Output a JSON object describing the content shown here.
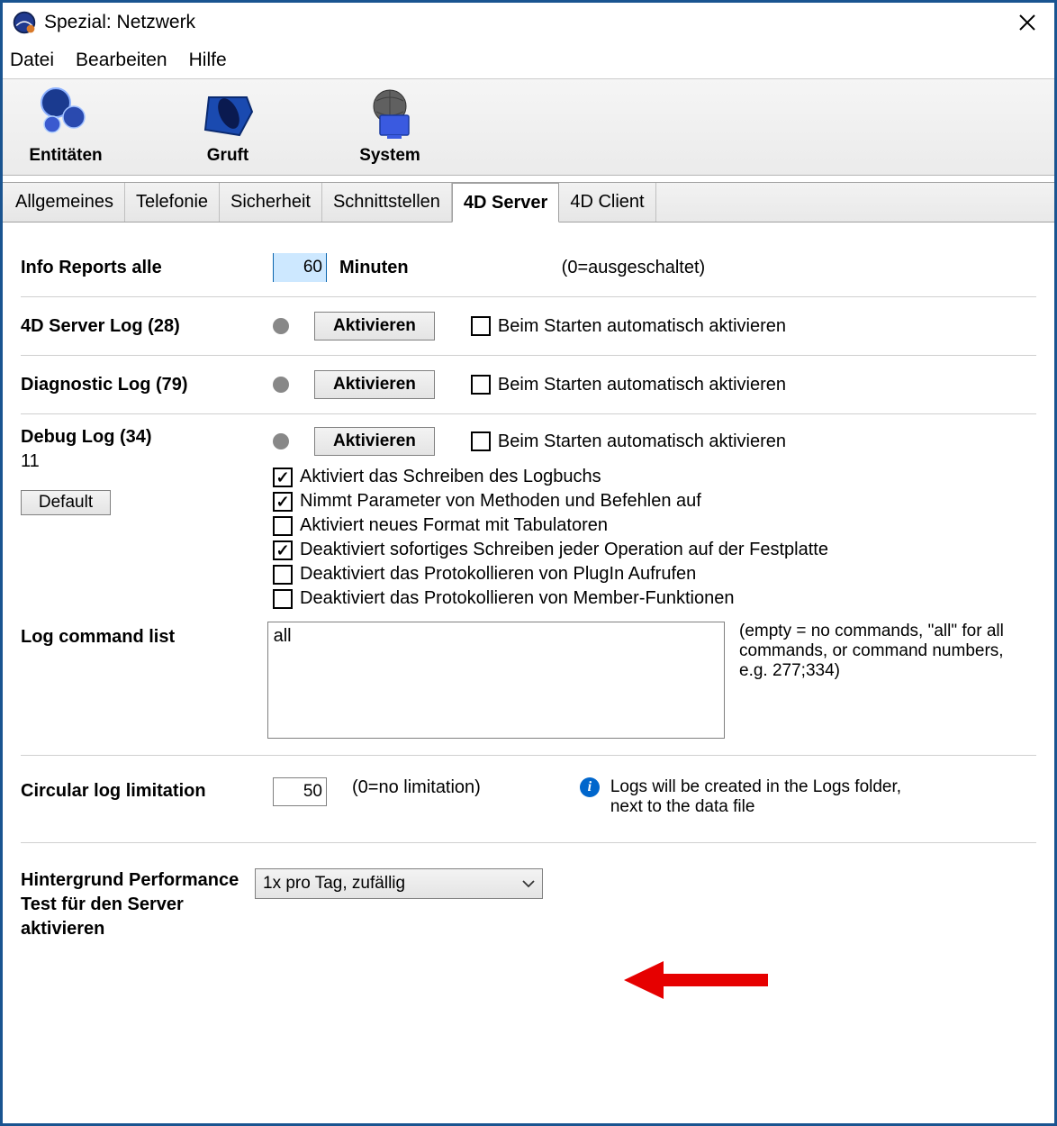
{
  "window": {
    "title": "Spezial: Netzwerk"
  },
  "menu": {
    "file": "Datei",
    "edit": "Bearbeiten",
    "help": "Hilfe"
  },
  "toolbar": {
    "entities": "Entitäten",
    "gruft": "Gruft",
    "system": "System"
  },
  "tabs": {
    "general": "Allgemeines",
    "telephony": "Telefonie",
    "security": "Sicherheit",
    "interfaces": "Schnittstellen",
    "server": "4D Server",
    "client": "4D Client"
  },
  "info_reports": {
    "label": "Info Reports alle",
    "value": "60",
    "unit": "Minuten",
    "hint": "(0=ausgeschaltet)"
  },
  "server_log": {
    "label": "4D Server Log (28)",
    "button": "Aktivieren",
    "autostart": "Beim Starten automatisch aktivieren"
  },
  "diag_log": {
    "label": "Diagnostic Log (79)",
    "button": "Aktivieren",
    "autostart": "Beim Starten automatisch aktivieren"
  },
  "debug_log": {
    "label": "Debug Log (34)",
    "subvalue": "11",
    "default_btn": "Default",
    "button": "Aktivieren",
    "autostart": "Beim Starten automatisch aktivieren",
    "opt1": "Aktiviert das Schreiben des Logbuchs",
    "opt2": "Nimmt Parameter von Methoden und Befehlen auf",
    "opt3": "Aktiviert neues Format mit Tabulatoren",
    "opt4": "Deaktiviert sofortiges Schreiben jeder Operation auf der Festplatte",
    "opt5": "Deaktiviert das Protokollieren von PlugIn Aufrufen",
    "opt6": "Deaktiviert das Protokollieren von Member-Funktionen"
  },
  "log_cmd": {
    "label": "Log command list",
    "value": "all",
    "help": "(empty = no commands, \"all\" for all commands, or command numbers, e.g. 277;334)"
  },
  "circular": {
    "label": "Circular log limitation",
    "value": "50",
    "hint": "(0=no limitation)",
    "info": "Logs will be created in the Logs folder, next to the data file"
  },
  "perf_test": {
    "label": "Hintergrund Performance Test für den Server aktivieren",
    "selected": "1x pro Tag, zufällig"
  }
}
